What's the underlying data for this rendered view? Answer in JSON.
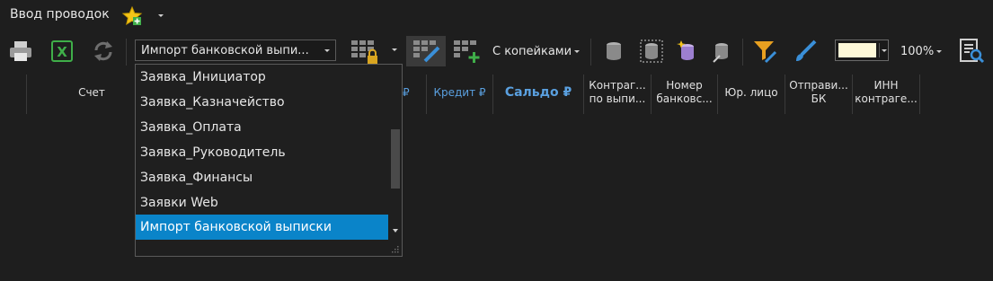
{
  "window": {
    "title": "Ввод проводок"
  },
  "toolbar": {
    "print_icon": "printer-icon",
    "excel_icon": "excel-icon",
    "refresh_icon": "refresh-icon",
    "template_combo": {
      "value": "Импорт банковской выпи..."
    },
    "copecks_label": "С копейками",
    "zoom_value": "100%",
    "fill_color": "#fdf8d8"
  },
  "columns": {
    "account": "Счет",
    "debit_partial": "₽",
    "credit": "Кредит ₽",
    "balance": "Сальдо ₽",
    "counterparty_1": "Контраг...",
    "counterparty_2": "по выпи...",
    "bank_number_1": "Номер",
    "bank_number_2": "банковс...",
    "legal_entity": "Юр. лицо",
    "sender_1": "Отправи...",
    "sender_2": "БК",
    "inn_1": "ИНН",
    "inn_2": "контраге..."
  },
  "dropdown": {
    "items": [
      "Заявка_Инициатор",
      "Заявка_Казначейство",
      "Заявка_Оплата",
      "Заявка_Руководитель",
      "Заявка_Финансы",
      "Заявки Web",
      "Импорт банковской выписки"
    ],
    "selected": "Импорт банковской выписки"
  }
}
